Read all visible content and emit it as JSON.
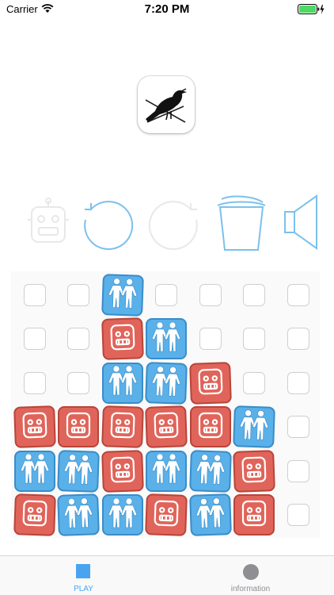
{
  "status_bar": {
    "carrier": "Carrier",
    "time": "7:20 PM",
    "battery_level": 1.0
  },
  "app_icon": {
    "name": "bird-logo-icon"
  },
  "toolbar": {
    "buttons": [
      {
        "name": "robot-button",
        "icon": "robot-icon",
        "enabled": false
      },
      {
        "name": "undo-button",
        "icon": "undo-arrow-icon",
        "enabled": true
      },
      {
        "name": "redo-button",
        "icon": "redo-arrow-icon",
        "enabled": false
      },
      {
        "name": "trash-button",
        "icon": "trash-icon",
        "enabled": true
      },
      {
        "name": "sound-button",
        "icon": "speaker-icon",
        "enabled": true
      }
    ]
  },
  "board": {
    "columns": 7,
    "rows": 6,
    "cells": [
      [
        "empty",
        "empty",
        "twins",
        "empty",
        "empty",
        "empty",
        "empty"
      ],
      [
        "empty",
        "empty",
        "robot",
        "twins",
        "empty",
        "empty",
        "empty"
      ],
      [
        "empty",
        "empty",
        "twins",
        "twins",
        "robot",
        "empty",
        "empty"
      ],
      [
        "robot",
        "robot",
        "robot",
        "robot",
        "robot",
        "twins",
        "empty"
      ],
      [
        "twins",
        "twins",
        "robot",
        "twins",
        "twins",
        "robot",
        "empty"
      ],
      [
        "robot",
        "twins",
        "twins",
        "robot",
        "twins",
        "robot",
        "empty"
      ]
    ]
  },
  "colors": {
    "accent": "#4aa3f0",
    "robot_tile": "#e0645a",
    "twins_tile": "#5ab0e8",
    "inactive_tab": "#8e8e93",
    "toolbar_icon": "#7cc0ec",
    "toolbar_icon_disabled": "#e8e8e8"
  },
  "tabs": [
    {
      "label": "PLAY",
      "active": true,
      "icon": "square-icon"
    },
    {
      "label": "information",
      "active": false,
      "icon": "circle-icon"
    }
  ]
}
